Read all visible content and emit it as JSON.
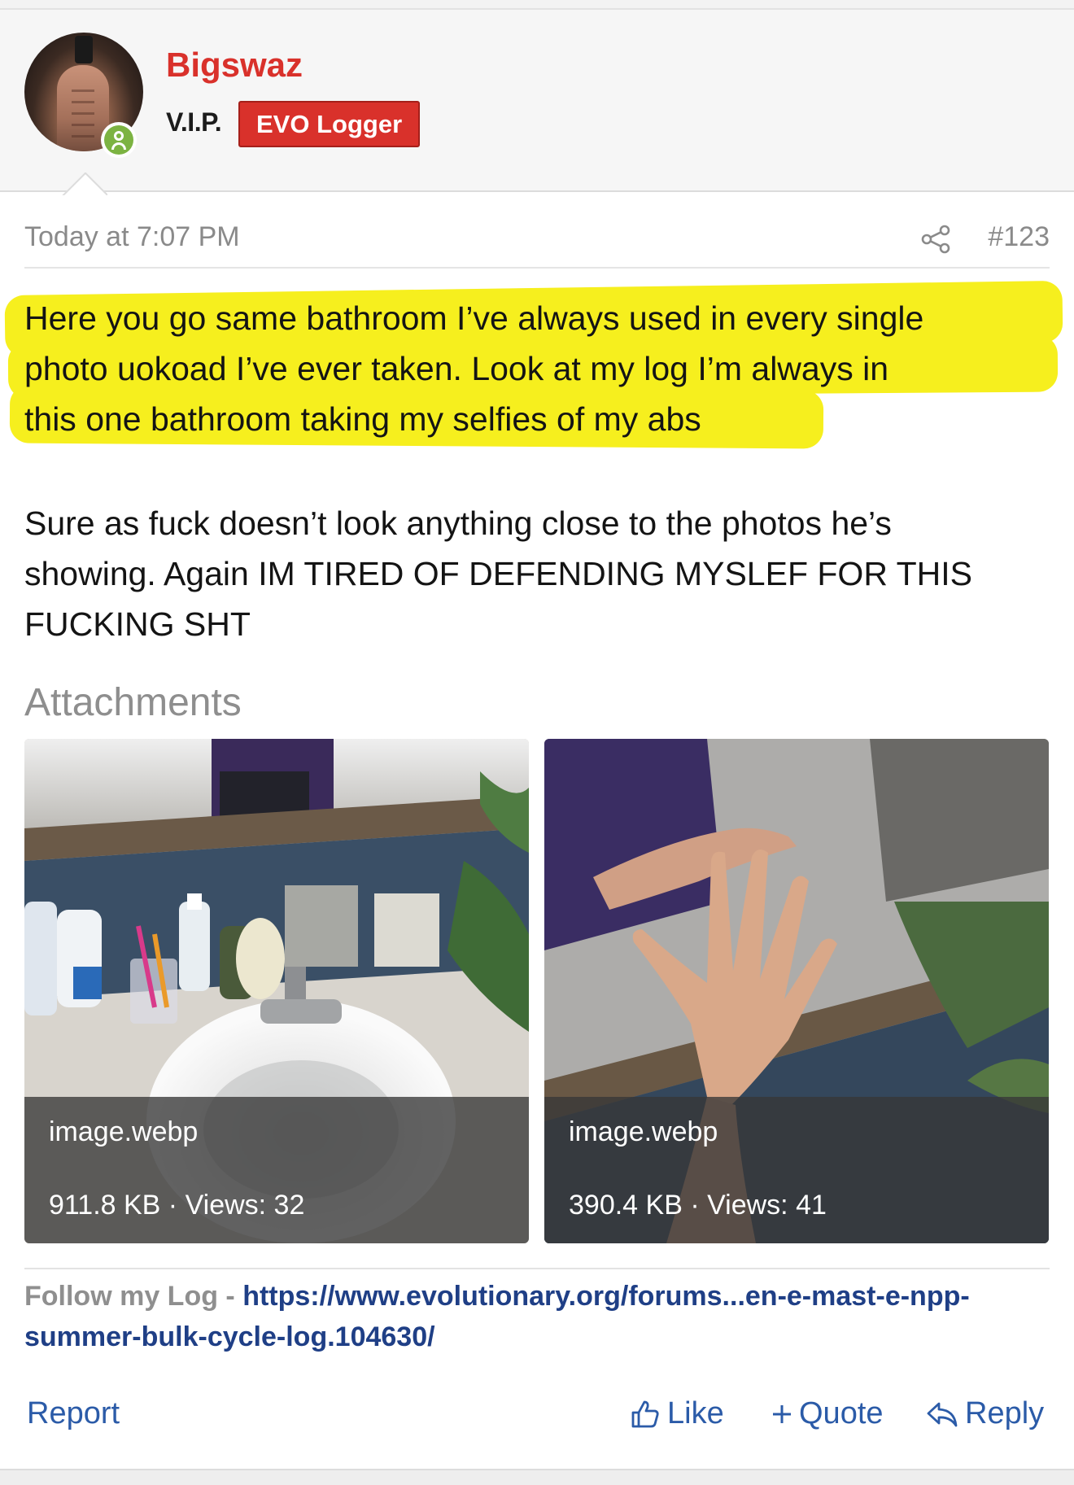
{
  "user": {
    "name": "Bigswaz",
    "title": "V.I.P.",
    "banner": "EVO Logger",
    "avatar": "user-avatar-photo",
    "online_icon": "user-online-icon"
  },
  "post": {
    "date": "Today at 7:07 PM",
    "number": "#123",
    "share_icon": "share-icon",
    "message_highlighted": [
      "Here you go same bathroom I’ve always used in every single",
      "photo uokoad I’ve ever taken. Look at my log I’m always in",
      "this one bathroom taking my selfies of my abs"
    ],
    "message_lines": [
      "Sure as fuck doesn’t look anything close to the photos he’s",
      "showing. Again IM TIRED OF DEFENDING MYSLEF FOR THIS",
      "FUCKING SHT"
    ],
    "highlight_color": "#f6ef1e"
  },
  "attachments": {
    "title": "Attachments",
    "items": [
      {
        "filename": "image.webp",
        "info": "911.8 KB · Views: 32"
      },
      {
        "filename": "image.webp",
        "info": "390.4 KB · Views: 41"
      }
    ]
  },
  "signature": {
    "label": "Follow my Log - ",
    "link": "https://www.evolutionary.org/forums...en-e-mast-e-npp-summer-bulk-cycle-log.104630/"
  },
  "actions": {
    "report": "Report",
    "like": "Like",
    "quote": "Quote",
    "reply": "Reply"
  },
  "colors": {
    "brand_red": "#d9312b",
    "link_blue": "#2b5ba8",
    "signature_link": "#1f3f86",
    "online_green": "#7cb342"
  }
}
